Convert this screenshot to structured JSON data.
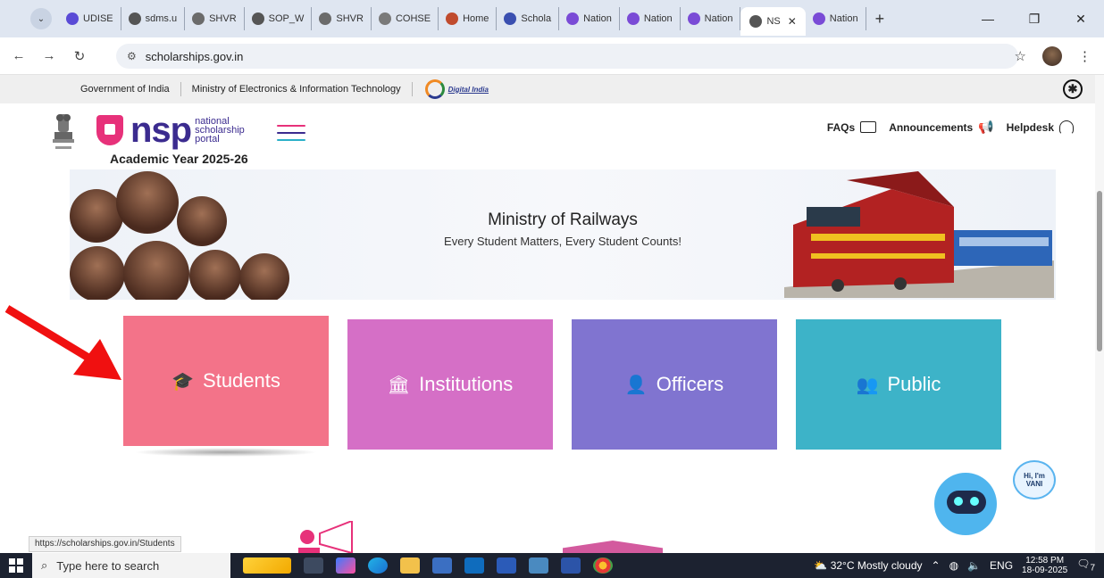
{
  "browser": {
    "tabs": [
      {
        "label": "UDISE",
        "color": "#5a4bd6"
      },
      {
        "label": "sdms.u",
        "color": "#555555"
      },
      {
        "label": "SHVR",
        "color": "#6b6b6b"
      },
      {
        "label": "SOP_W",
        "color": "#555555"
      },
      {
        "label": "SHVR",
        "color": "#6b6b6b"
      },
      {
        "label": "COHSE",
        "color": "#7a7a7a"
      },
      {
        "label": "Home",
        "color": "#c04b2e"
      },
      {
        "label": "Schola",
        "color": "#3a4fb0"
      },
      {
        "label": "Nation",
        "color": "#7a4bd6"
      },
      {
        "label": "Nation",
        "color": "#7a4bd6"
      },
      {
        "label": "Nation",
        "color": "#7a4bd6"
      }
    ],
    "active_tab": {
      "label": "NS",
      "close": "✕"
    },
    "after_tabs": [
      {
        "label": "Nation",
        "color": "#7a4bd6"
      }
    ],
    "new_tab": "+",
    "window_controls": {
      "minimize": "—",
      "restore": "❐",
      "close": "✕"
    },
    "url": "scholarships.gov.in",
    "site_info": "⚙",
    "nav": {
      "back": "←",
      "forward": "→",
      "reload": "↻"
    },
    "star": "☆",
    "menu": "⋮"
  },
  "gov_strip": {
    "items": [
      "Government of India",
      "Ministry of Electronics & Information Technology"
    ],
    "digital_india": "Digital India"
  },
  "header": {
    "logo_text": "nsp",
    "logo_sub": [
      "national",
      "scholarship",
      "portal"
    ],
    "academic_year": "Academic Year 2025-26",
    "links": [
      {
        "label": "FAQs"
      },
      {
        "label": "Announcements"
      },
      {
        "label": "Helpdesk"
      }
    ],
    "hamburger_colors": [
      "#e7317a",
      "#3b2b8f",
      "#2bb0c9"
    ]
  },
  "banner": {
    "title": "Ministry of Railways",
    "subtitle": "Every Student Matters, Every Student Counts!"
  },
  "cards": [
    {
      "label": "Students",
      "icon": "🎓",
      "color": "#f37389"
    },
    {
      "label": "Institutions",
      "icon": "🏛",
      "color": "#d56fc6"
    },
    {
      "label": "Officers",
      "icon": "👤",
      "color": "#8074d0"
    },
    {
      "label": "Public",
      "icon": "👥",
      "color": "#3db3c8"
    }
  ],
  "vani": {
    "greeting": "Hi, I'm VANI"
  },
  "status_url": "https://scholarships.gov.in/Students",
  "taskbar": {
    "search_placeholder": "Type here to search",
    "weather": "32°C  Mostly cloudy",
    "lang": "ENG",
    "time": "12:58 PM",
    "date": "18-09-2025",
    "notif_count": "7"
  }
}
